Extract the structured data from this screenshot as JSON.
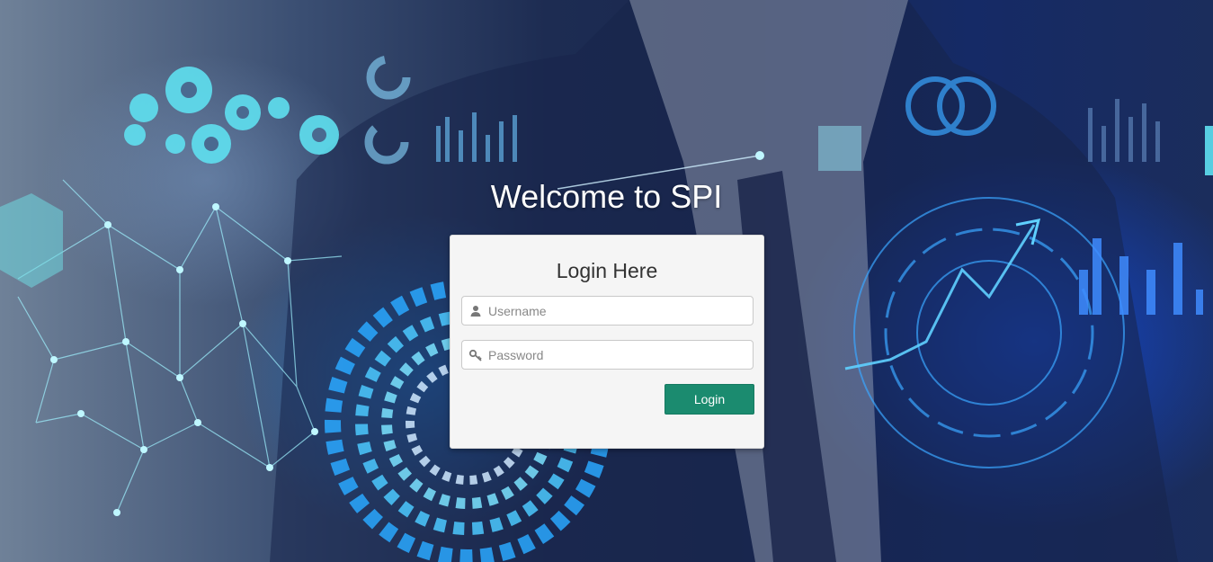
{
  "page": {
    "welcome_title": "Welcome to SPI"
  },
  "login_form": {
    "title": "Login Here",
    "username": {
      "placeholder": "Username",
      "value": "",
      "icon": "user-icon"
    },
    "password": {
      "placeholder": "Password",
      "value": "",
      "icon": "key-icon"
    },
    "submit_label": "Login"
  },
  "colors": {
    "accent": "#1b8b6f",
    "card_background": "#f5f5f5",
    "background_dark": "#1a2850"
  }
}
